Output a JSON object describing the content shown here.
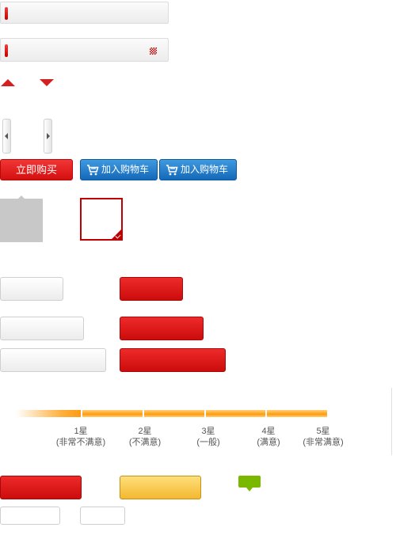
{
  "buttons": {
    "buy_now": "立即购买",
    "add_to_cart_1": "加入购物车",
    "add_to_cart_2": "加入购物车"
  },
  "rating": {
    "levels": [
      {
        "star": "1星",
        "desc": "(非常不满意)"
      },
      {
        "star": "2星",
        "desc": "(不满意)"
      },
      {
        "star": "3星",
        "desc": "(一般)"
      },
      {
        "star": "4星",
        "desc": "(满意)"
      },
      {
        "star": "5星",
        "desc": "(非常满意)"
      }
    ]
  },
  "icons": {
    "cart": "cart-icon",
    "checker": "checker-icon",
    "check": "check-icon"
  },
  "colors": {
    "accent_red": "#d40f0f",
    "blue": "#1468b8",
    "orange": "#ff9a10",
    "green": "#7ab800"
  }
}
